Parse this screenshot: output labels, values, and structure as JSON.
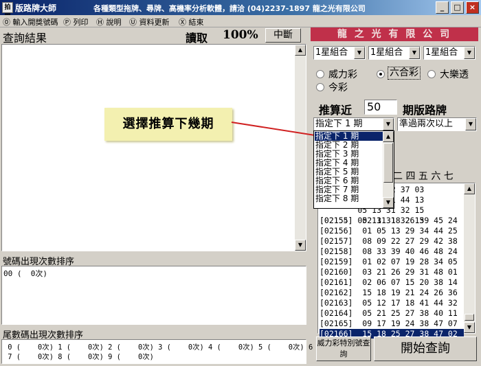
{
  "window": {
    "app_icon": "拍閃",
    "app_title": "版路牌大師",
    "caption": "各種類型拖牌、尋牌、高機率分析軟體，請洽 (04)2237-1897 龍之光有限公司",
    "min_label": "_",
    "max_label": "□",
    "close_label": "×"
  },
  "menu": [
    {
      "key": "⓪",
      "label": "輸入開獎號碼"
    },
    {
      "key": "Ⓟ",
      "label": "列印"
    },
    {
      "key": "Ⓗ",
      "label": "說明"
    },
    {
      "key": "Ⓤ",
      "label": "資料更新"
    },
    {
      "key": "Ⓧ",
      "label": "結束"
    }
  ],
  "left": {
    "results_label": "查詢結果",
    "read_label": "讀取",
    "progress": "100%",
    "stop_button": "中斷",
    "numbers_label": "號碼出現次數排序",
    "numbers_line": "00 (  0次)",
    "tail_label": "尾數碼出現次數排序",
    "tail_line1": " 0 (    0次) 1 (    0次) 2 (    0次) 3 (    0次) 4 (    0次) 5 (    0次) 6 (    0次)",
    "tail_line2": " 7 (    0次) 8 (    0次) 9 (    0次)"
  },
  "callout": {
    "text": "選擇推算下幾期",
    "line_color": "#d02020"
  },
  "right": {
    "company": "龍 之 光 有 限 公 司",
    "company_bg": "#c0304a",
    "combos": [
      "1星組合",
      "1星組合",
      "1星組合"
    ],
    "games": [
      {
        "label": "威力彩",
        "selected": false
      },
      {
        "label": "六合彩",
        "selected": true
      },
      {
        "label": "大樂透",
        "selected": false
      },
      {
        "label": "今彩",
        "selected": false
      }
    ],
    "calc_label": "推算近",
    "calc_value": "50",
    "period_label": "期版路牌",
    "period_select": "指定下 1 期",
    "filter_select": "準過兩次以上",
    "period_options": [
      "指定下 1 期",
      "指定下 2 期",
      "指定下 3 期",
      "指定下 4 期",
      "指定下 5 期",
      "指定下 6 期",
      "指定下 7 期",
      "指定下 8 期"
    ],
    "headers_partial": "二 四 五 六 七",
    "draws_hidden": [
      {
        "id": "",
        "nums": "        29 15 22 37 03"
      },
      {
        "id": "",
        "nums": "        09 40 41 44 13"
      },
      {
        "id": "",
        "nums": "        05 13 31 32 15"
      },
      {
        "id": "[02154]",
        "nums": "        05 13 31 32 15"
      }
    ],
    "draws": [
      "[02155]  02 11 18 26 39 45 24",
      "[02156]  01 05 13 29 34 44 25",
      "[02157]  08 09 22 27 29 42 38",
      "[02158]  08 33 39 40 46 48 24",
      "[02159]  01 02 07 19 28 34 05",
      "[02160]  03 21 26 29 31 48 01",
      "[02161]  02 06 07 15 20 38 14",
      "[02162]  15 18 19 21 24 26 36",
      "[02163]  05 12 17 18 41 44 32",
      "[02164]  05 21 25 27 38 40 11",
      "[02165]  09 17 19 24 38 47 07",
      "[02166]  15 18 25 27 38 47 02"
    ],
    "special_button": "威力彩特別號查詢",
    "start_button": "開始查詢"
  }
}
